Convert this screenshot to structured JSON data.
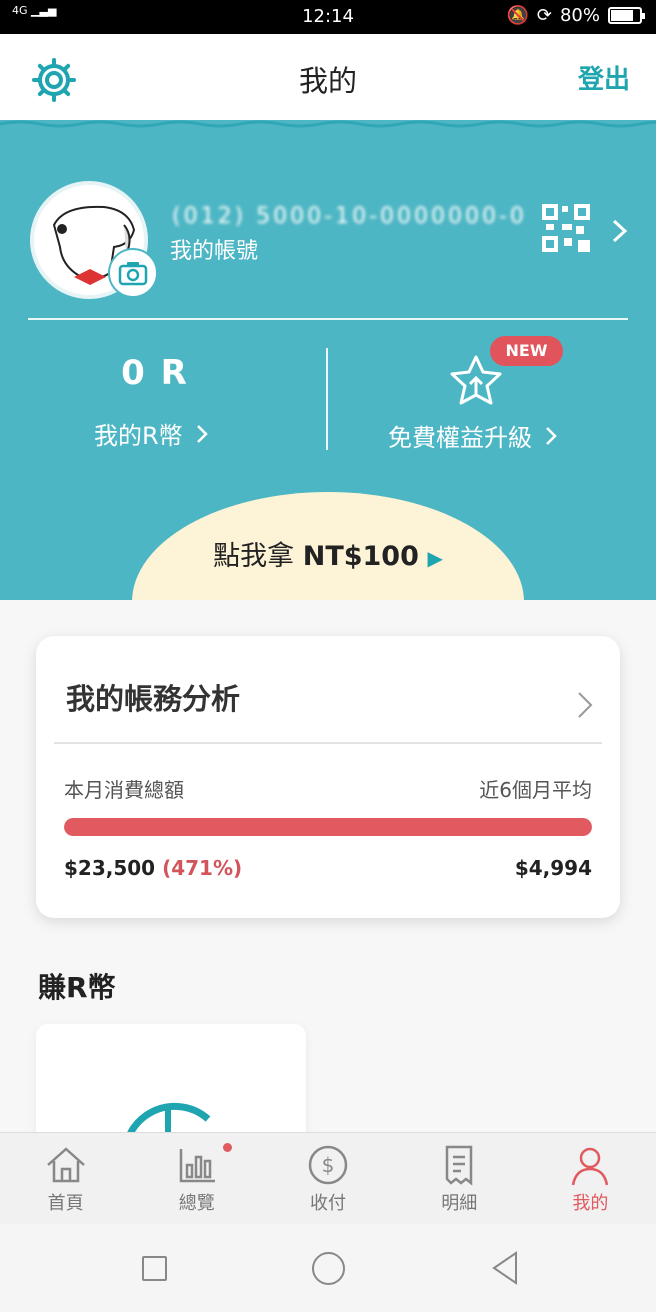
{
  "status_bar": {
    "network": "4G",
    "time": "12:14",
    "battery": "80%",
    "battery_level": 0.8
  },
  "header": {
    "title": "我的",
    "logout_label": "登出",
    "settings_icon": "gear-icon"
  },
  "profile": {
    "account_id": "(012) 5000-10-0000000-0",
    "account_label": "我的帳號",
    "camera_icon": "camera-icon",
    "qr_icon": "qr-code-icon"
  },
  "rcoin": {
    "value": "0 R",
    "label": "我的R幣"
  },
  "upgrade": {
    "badge": "NEW",
    "label": "免費權益升級"
  },
  "promo": {
    "prefix": "點我拿 ",
    "amount": "NT$100"
  },
  "analysis": {
    "title": "我的帳務分析",
    "left_label": "本月消費總額",
    "right_label": "近6個月平均",
    "amount": "$23,500",
    "percent": "(471%)",
    "average": "$4,994",
    "bar_fraction": 1.0,
    "bar_color": "#e05a60"
  },
  "earn_section": {
    "title": "賺R幣"
  },
  "tabs": [
    {
      "label": "首頁",
      "icon": "home-icon"
    },
    {
      "label": "總覽",
      "icon": "chart-icon"
    },
    {
      "label": "收付",
      "icon": "dollar-icon"
    },
    {
      "label": "明細",
      "icon": "receipt-icon"
    },
    {
      "label": "我的",
      "icon": "person-icon"
    }
  ],
  "colors": {
    "teal": "#4db6c4",
    "accent": "#1fa5b0",
    "red": "#e05a60"
  }
}
